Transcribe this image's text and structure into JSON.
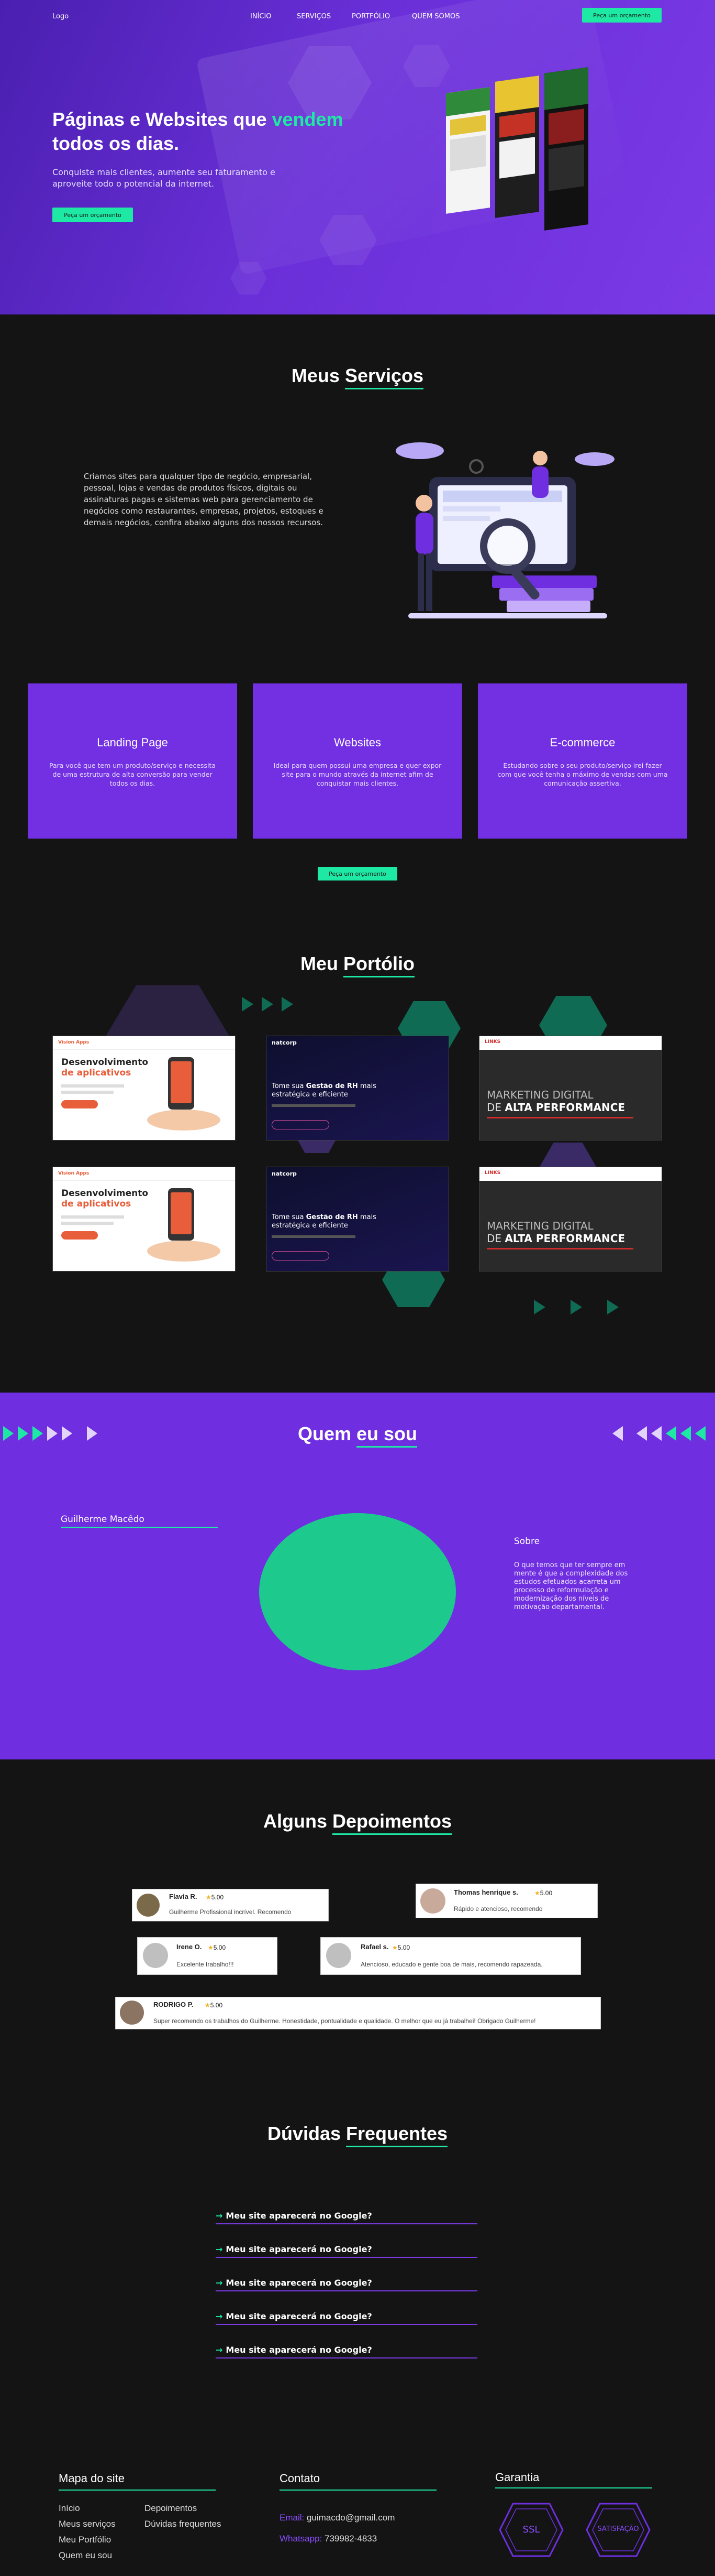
{
  "colors": {
    "accent": "#1de9a4",
    "purple": "#6f2fe0",
    "bg": "#141415"
  },
  "nav": {
    "logo": "Logo",
    "items": [
      "INÍCIO",
      "SERVIÇOS",
      "PORTFÓLIO",
      "QUEM SOMOS"
    ],
    "cta": "Peça um orçamento"
  },
  "hero": {
    "title_a": "Páginas e Websites que ",
    "title_b": "vendem",
    "title_c": "todos os dias.",
    "subtitle": "Conquiste mais clientes, aumente seu faturamento e aproveite todo o potencial da internet.",
    "cta": "Peça um orçamento"
  },
  "services": {
    "title_a": "Meus ",
    "title_b": "Serviços",
    "text": "Criamos sites para qualquer tipo de negócio, empresarial, pessoal, lojas e vendas de produtos físicos, digitais ou assinaturas pagas e sistemas web para gerenciamento de negócios como restaurantes, empresas, projetos, estoques e demais negócios, confira abaixo alguns dos nossos recursos.",
    "cards": [
      {
        "title": "Landing Page",
        "text": "Para você que tem um produto/serviço e necessita de uma estrutura de alta conversão para vender todos os dias."
      },
      {
        "title": "Websites",
        "text": "Ideal para quem possui uma empresa e quer expor site para o mundo através da internet afim de conquistar mais clientes."
      },
      {
        "title": "E-commerce",
        "text": "Estudando sobre o seu produto/serviço irei fazer com que você tenha o máximo de vendas com uma comunicação assertiva."
      }
    ],
    "cta": "Peça um orçamento"
  },
  "portfolio": {
    "title_a": "Meu ",
    "title_b": "Portólio",
    "items": [
      {
        "brand": "Vision Apps",
        "heading_a": "Desenvolvimento",
        "heading_b": "de aplicativos"
      },
      {
        "brand": "natcorp",
        "heading_a": "Tome sua ",
        "heading_b": "Gestão de RH",
        "heading_c": " mais estratégica e eficiente"
      },
      {
        "brand": "LINKS",
        "heading_a": "MARKETING DIGITAL",
        "heading_b": "DE ",
        "heading_c": "ALTA PERFORMANCE"
      },
      {
        "brand": "Vision Apps",
        "heading_a": "Desenvolvimento",
        "heading_b": "de aplicativos"
      },
      {
        "brand": "natcorp",
        "heading_a": "Tome sua ",
        "heading_b": "Gestão de RH",
        "heading_c": " mais estratégica e eficiente"
      },
      {
        "brand": "LINKS",
        "heading_a": "MARKETING DIGITAL",
        "heading_b": "DE ",
        "heading_c": "ALTA PERFORMANCE"
      }
    ]
  },
  "about": {
    "title_a": "Quem ",
    "title_b": "eu sou",
    "name": "Guilherme Macêdo",
    "side_title": "Sobre",
    "side_text": "O que temos que ter sempre em mente é que a complexidade dos estudos efetuados acarreta um processo de reformulação e modernização dos níveis de motivação departamental."
  },
  "testimonials": {
    "title_a": "Alguns ",
    "title_b": "Depoimentos",
    "items": [
      {
        "name": "Flavia R.",
        "rating": "5.00",
        "text": "Guilherme Profissional incrível. Recomendo"
      },
      {
        "name": "Thomas henrique s.",
        "rating": "5.00",
        "text": "Rápido e atencioso, recomendo"
      },
      {
        "name": "Irene O.",
        "rating": "5.00",
        "text": "Excelente trabalho!!!"
      },
      {
        "name": "Rafael s.",
        "rating": "5.00",
        "text": "Atencioso, educado e gente boa de mais, recomendo rapazeada."
      },
      {
        "name": "RODRIGO P.",
        "rating": "5.00",
        "text": "Super recomendo os trabalhos do Guilherme. Honestidade, pontualidade e qualidade.  O melhor que eu já trabalhei! Obrigado Guilherme!"
      }
    ]
  },
  "faq": {
    "title_a": "Dúvidas ",
    "title_b": "Frequentes",
    "items": [
      "Meu site aparecerá no Google?",
      "Meu site aparecerá no Google?",
      "Meu site aparecerá no Google?",
      "Meu site aparecerá no Google?",
      "Meu site aparecerá no Google?"
    ]
  },
  "footer": {
    "sitemap_title": "Mapa do site",
    "links_a": [
      "Início",
      "Meus serviços",
      "Meu Portfólio",
      "Quem eu sou"
    ],
    "links_b": [
      "Depoimentos",
      "Dúvidas frequentes"
    ],
    "contact_title": "Contato",
    "email_label": "Email:",
    "email": "guimacdo@gmail.com",
    "whats_label": "Whatsapp:",
    "whats": "739982-4833",
    "guarantee_title": "Garantia",
    "badge1": "SSL",
    "badge2": "SATISFAÇÃO"
  }
}
